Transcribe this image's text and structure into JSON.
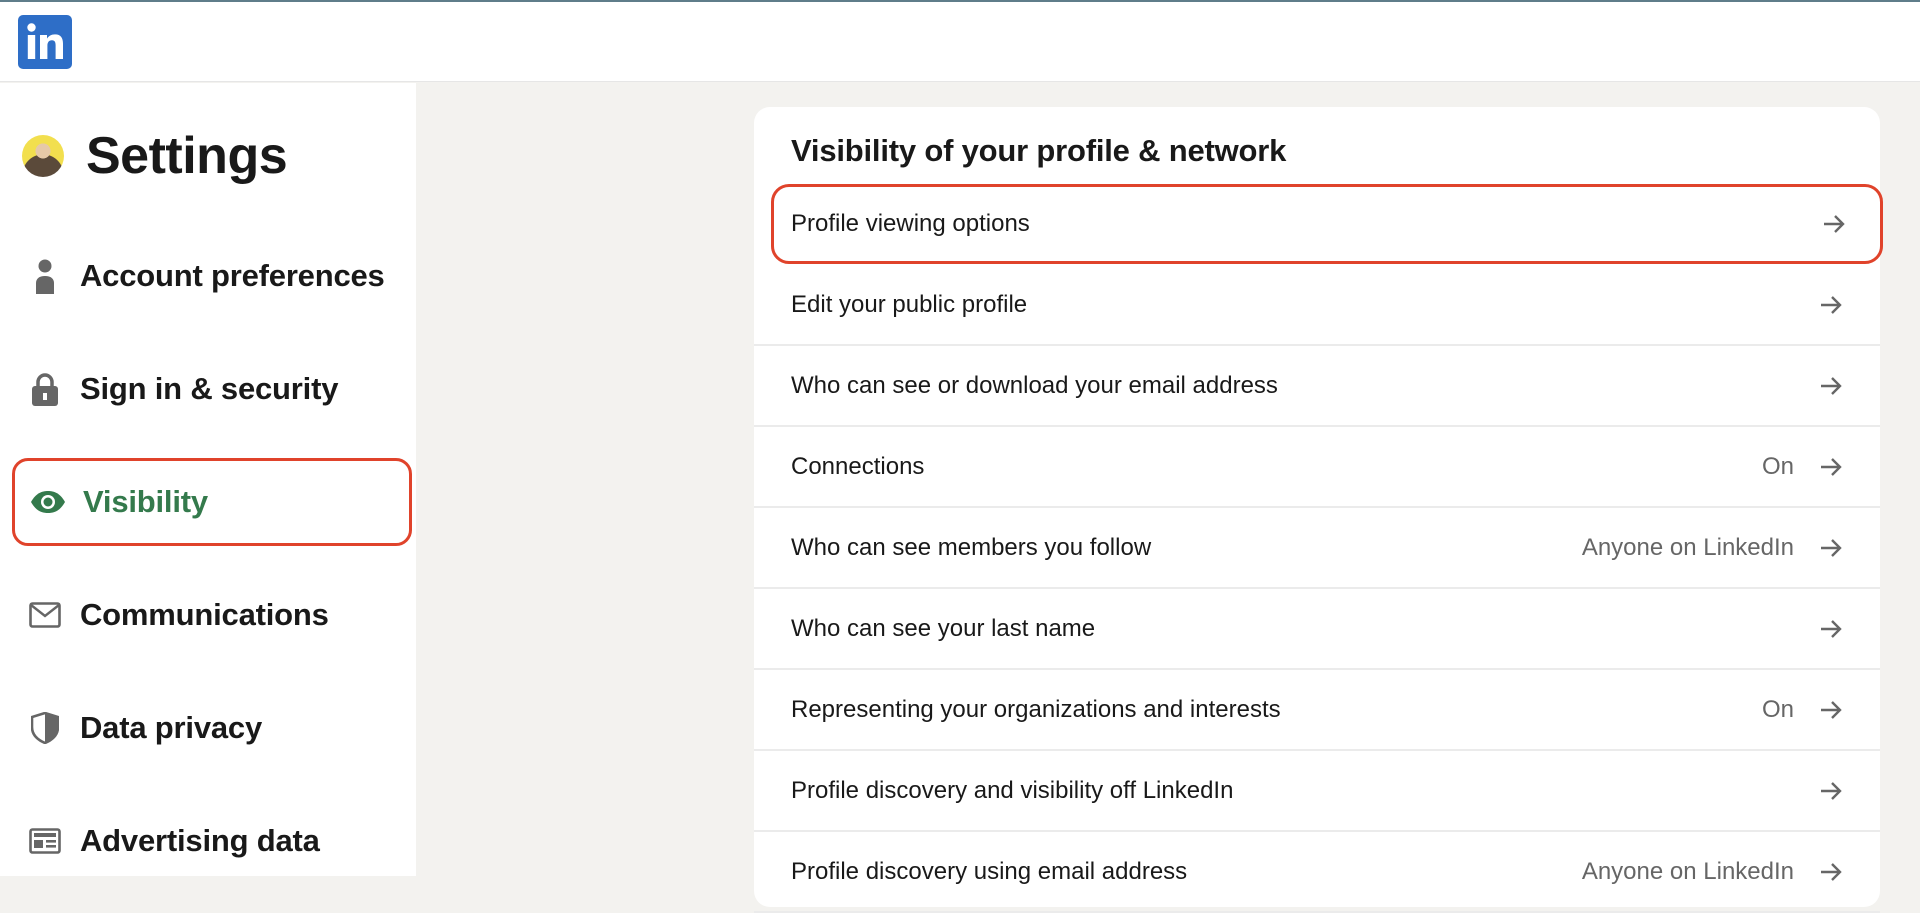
{
  "header": {
    "logo_text": "in",
    "logo_alt": "LinkedIn logo"
  },
  "sidebar": {
    "title": "Settings",
    "avatar_alt": "profile-photo",
    "items": [
      {
        "label": "Account preferences",
        "icon": "person-icon",
        "active": false
      },
      {
        "label": "Sign in & security",
        "icon": "lock-icon",
        "active": false
      },
      {
        "label": "Visibility",
        "icon": "eye-icon",
        "active": true
      },
      {
        "label": "Communications",
        "icon": "envelope-icon",
        "active": false
      },
      {
        "label": "Data privacy",
        "icon": "shield-icon",
        "active": false
      },
      {
        "label": "Advertising data",
        "icon": "ad-card-icon",
        "active": false
      }
    ]
  },
  "main": {
    "section_title": "Visibility of your profile & network",
    "rows": [
      {
        "label": "Profile viewing options",
        "value": "",
        "highlighted": true
      },
      {
        "label": "Edit your public profile",
        "value": ""
      },
      {
        "label": "Who can see or download your email address",
        "value": ""
      },
      {
        "label": "Connections",
        "value": "On"
      },
      {
        "label": "Who can see members you follow",
        "value": "Anyone on LinkedIn"
      },
      {
        "label": "Who can see your last name",
        "value": ""
      },
      {
        "label": "Representing your organizations and interests",
        "value": "On"
      },
      {
        "label": "Profile discovery and visibility off LinkedIn",
        "value": ""
      },
      {
        "label": "Profile discovery using email address",
        "value": "Anyone on LinkedIn"
      }
    ]
  },
  "colors": {
    "brand": "#2e6ec7",
    "active_nav": "#347a4c",
    "highlight_border": "#e0432b",
    "page_bg": "#f3f2ef",
    "muted_text": "#666666"
  }
}
